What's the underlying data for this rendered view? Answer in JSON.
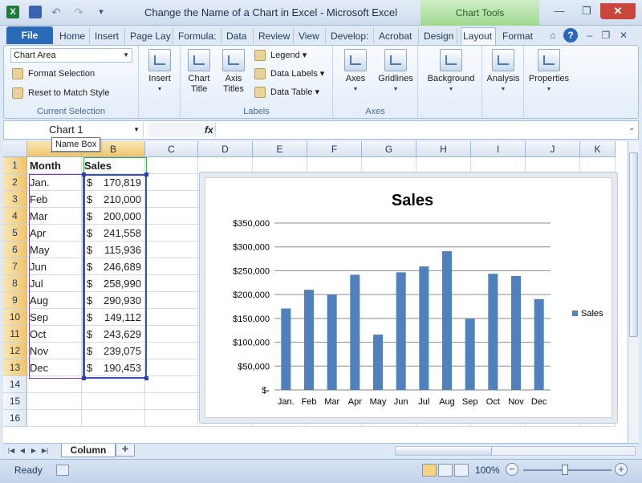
{
  "window": {
    "title": "Change the Name of a Chart in Excel  -  Microsoft Excel",
    "contextual_group": "Chart Tools"
  },
  "ribbon_tabs": [
    "File",
    "Home",
    "Insert",
    "Page Lay",
    "Formula:",
    "Data",
    "Review",
    "View",
    "Develop:",
    "Acrobat",
    "Design",
    "Layout",
    "Format"
  ],
  "ribbon": {
    "current_selection": {
      "selected": "Chart Area",
      "format_selection": "Format Selection",
      "reset": "Reset to Match Style",
      "label": "Current Selection"
    },
    "insert": "Insert",
    "labels": {
      "chart_title": "Chart\nTitle",
      "axis_titles": "Axis\nTitles",
      "legend": "Legend",
      "data_labels": "Data Labels",
      "data_table": "Data Table",
      "label": "Labels"
    },
    "axes": {
      "axes": "Axes",
      "gridlines": "Gridlines",
      "label": "Axes"
    },
    "background": "Background",
    "analysis": "Analysis",
    "properties": "Properties"
  },
  "formula_bar": {
    "name_box": "Chart 1",
    "fx": "fx",
    "tooltip": "Name Box"
  },
  "columns": [
    "A",
    "B",
    "C",
    "D",
    "E",
    "F",
    "G",
    "H",
    "I",
    "J",
    "K"
  ],
  "rows": [
    "1",
    "2",
    "3",
    "4",
    "5",
    "6",
    "7",
    "8",
    "9",
    "10",
    "11",
    "12",
    "13",
    "14",
    "15",
    "16"
  ],
  "table": {
    "headers": [
      "Month",
      "Sales"
    ],
    "rows": [
      {
        "month": "Jan.",
        "dollar": "$",
        "amount": "170,819"
      },
      {
        "month": "Feb",
        "dollar": "$",
        "amount": "210,000"
      },
      {
        "month": "Mar",
        "dollar": "$",
        "amount": "200,000"
      },
      {
        "month": "Apr",
        "dollar": "$",
        "amount": "241,558"
      },
      {
        "month": "May",
        "dollar": "$",
        "amount": "115,936"
      },
      {
        "month": "Jun",
        "dollar": "$",
        "amount": "246,689"
      },
      {
        "month": "Jul",
        "dollar": "$",
        "amount": "258,990"
      },
      {
        "month": "Aug",
        "dollar": "$",
        "amount": "290,930"
      },
      {
        "month": "Sep",
        "dollar": "$",
        "amount": "149,112"
      },
      {
        "month": "Oct",
        "dollar": "$",
        "amount": "243,629"
      },
      {
        "month": "Nov",
        "dollar": "$",
        "amount": "239,075"
      },
      {
        "month": "Dec",
        "dollar": "$",
        "amount": "190,453"
      }
    ]
  },
  "chart_data": {
    "type": "bar",
    "title": "Sales",
    "categories": [
      "Jan.",
      "Feb",
      "Mar",
      "Apr",
      "May",
      "Jun",
      "Jul",
      "Aug",
      "Sep",
      "Oct",
      "Nov",
      "Dec"
    ],
    "series": [
      {
        "name": "Sales",
        "values": [
          170819,
          210000,
          200000,
          241558,
          115936,
          246689,
          258990,
          290930,
          149112,
          243629,
          239075,
          190453
        ],
        "color": "#4f81bd"
      }
    ],
    "ylim": [
      0,
      350000
    ],
    "yticks": [
      "$-",
      "$50,000",
      "$100,000",
      "$150,000",
      "$200,000",
      "$250,000",
      "$300,000",
      "$350,000"
    ],
    "gridlines": true,
    "legend": "right"
  },
  "sheet_tabs": {
    "active": "Column"
  },
  "status": {
    "ready": "Ready",
    "zoom": "100%"
  }
}
